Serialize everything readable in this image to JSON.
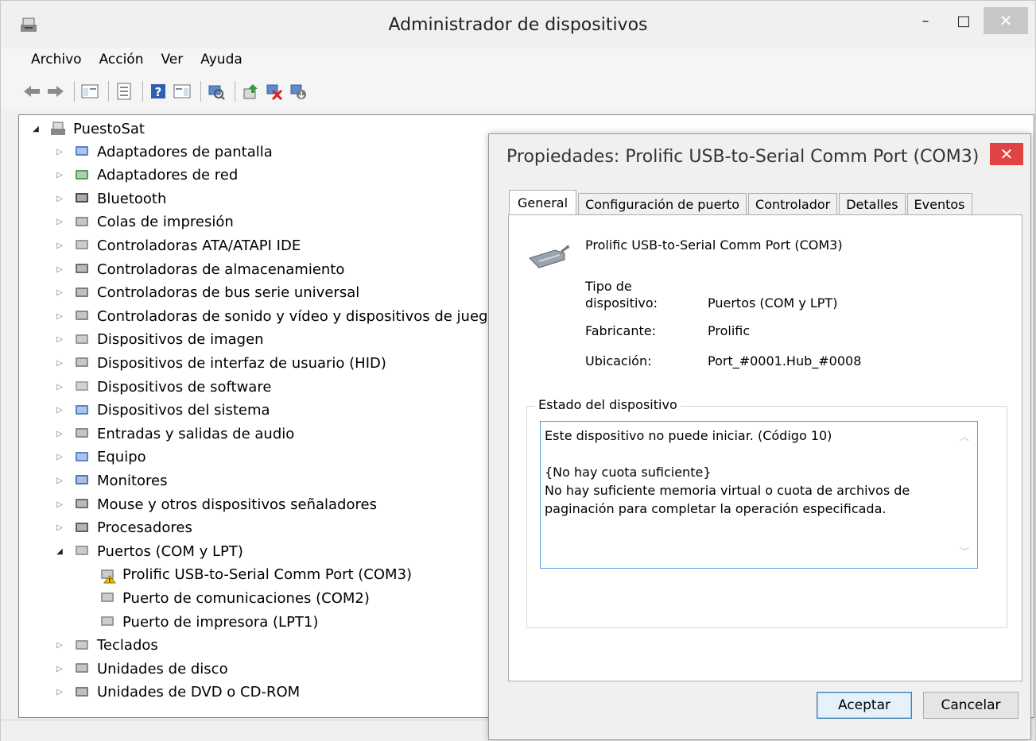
{
  "window": {
    "title": "Administrador de dispositivos",
    "controls": {
      "minimize": "–",
      "maximize": "□",
      "close": "✕"
    }
  },
  "menu": [
    "Archivo",
    "Acción",
    "Ver",
    "Ayuda"
  ],
  "toolbar": [
    "back-arrow-icon",
    "forward-arrow-icon",
    "show-hide-tree-icon",
    "properties-icon",
    "help-icon",
    "action-pane-icon",
    "scan-hardware-icon",
    "update-driver-icon",
    "uninstall-device-icon",
    "enable-device-icon"
  ],
  "tree": {
    "root": "PuestoSat",
    "categories": [
      "Adaptadores de pantalla",
      "Adaptadores de red",
      "Bluetooth",
      "Colas de impresión",
      "Controladoras ATA/ATAPI IDE",
      "Controladoras de almacenamiento",
      "Controladoras de bus serie universal",
      "Controladoras de sonido y vídeo y dispositivos de juego",
      "Dispositivos de imagen",
      "Dispositivos de interfaz de usuario (HID)",
      "Dispositivos de software",
      "Dispositivos del sistema",
      "Entradas y salidas de audio",
      "Equipo",
      "Monitores",
      "Mouse y otros dispositivos señaladores",
      "Procesadores",
      "Puertos (COM y LPT)"
    ],
    "ports_children": [
      "Prolific USB-to-Serial Comm Port (COM3)",
      "Puerto de comunicaciones (COM2)",
      "Puerto de impresora (LPT1)"
    ],
    "trailing": [
      "Teclados",
      "Unidades de disco",
      "Unidades de DVD o CD-ROM"
    ]
  },
  "dialog": {
    "title": "Propiedades: Prolific USB-to-Serial Comm Port (COM3)",
    "close": "✕",
    "tabs": [
      "General",
      "Configuración de puerto",
      "Controlador",
      "Detalles",
      "Eventos"
    ],
    "device_name": "Prolific USB-to-Serial Comm Port (COM3)",
    "type_label_1": "Tipo de",
    "type_label_2": "dispositivo:",
    "type_value": "Puertos (COM y LPT)",
    "manufacturer_label": "Fabricante:",
    "manufacturer_value": "Prolific",
    "location_label": "Ubicación:",
    "location_value": "Port_#0001.Hub_#0008",
    "status_group": "Estado del dispositivo",
    "status_lines": [
      "Este dispositivo no puede iniciar. (Código 10)",
      "",
      "{No hay cuota suficiente}",
      "No hay suficiente memoria virtual o cuota de archivos de",
      "paginación para completar la operación especificada."
    ],
    "ok": "Aceptar",
    "cancel": "Cancelar"
  }
}
